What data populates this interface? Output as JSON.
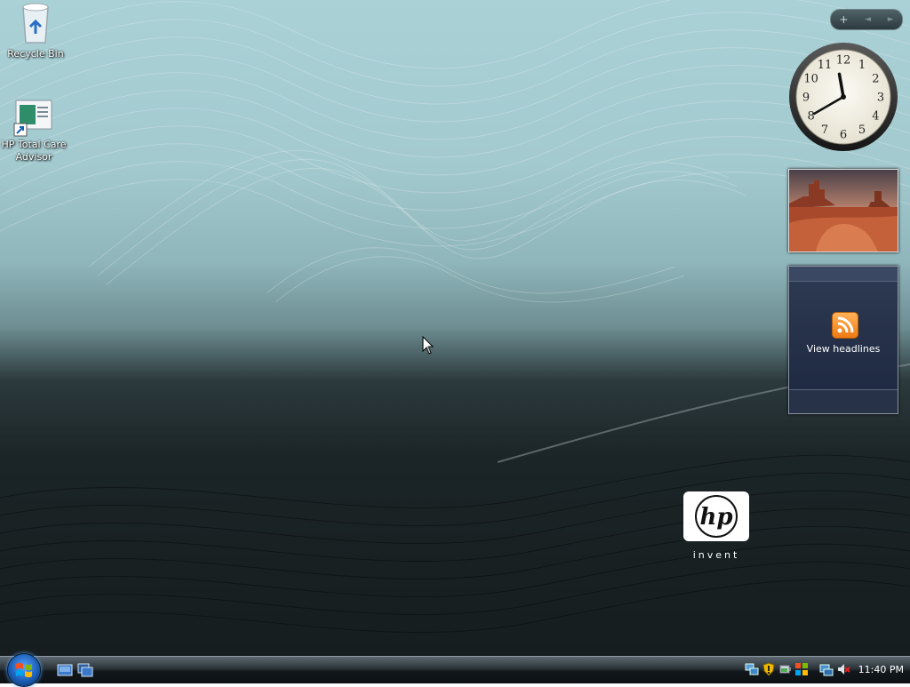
{
  "desktop": {
    "icons": [
      {
        "label": "Recycle Bin"
      },
      {
        "label": "HP Total Care Advisor"
      }
    ]
  },
  "sidebar": {
    "controls": {
      "add": "+",
      "prev": "◄",
      "next": "►"
    },
    "clock": {
      "numbers": [
        "12",
        "1",
        "2",
        "3",
        "4",
        "5",
        "6",
        "7",
        "8",
        "9",
        "10",
        "11"
      ],
      "time": "11:40"
    },
    "feed": {
      "label": "View headlines"
    }
  },
  "wallpaper": {
    "logo_text": "hp",
    "tagline": "invent"
  },
  "taskbar": {
    "clock": "11:40 PM"
  },
  "colors": {
    "wallpaper_top": "#a9d1d6",
    "wallpaper_bottom": "#161d1f",
    "feed_orange": "#ef7a12",
    "start_blue": "#1c5fb7"
  }
}
